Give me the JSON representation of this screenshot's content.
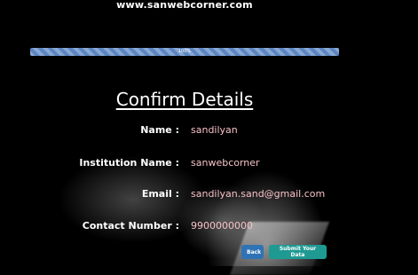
{
  "header": {
    "site_name": "www.sanwebcorner.com"
  },
  "progress": {
    "value_percent": 100,
    "label": "100%"
  },
  "main": {
    "title": "Confirm Details",
    "rows": [
      {
        "label": "Name :",
        "value": "sandilyan"
      },
      {
        "label": "Institution Name :",
        "value": "sanwebcorner"
      },
      {
        "label": "Email :",
        "value": "sandilyan.sand@gmail.com"
      },
      {
        "label": "Contact Number :",
        "value": "9900000000"
      }
    ]
  },
  "actions": {
    "back_label": "Back",
    "submit_label": "Submit Your Data"
  },
  "colors": {
    "progress_fill": "#5b86c2",
    "value_text": "#f7c1c7",
    "back_button": "#2f73b5",
    "submit_button": "#1f9a93"
  }
}
